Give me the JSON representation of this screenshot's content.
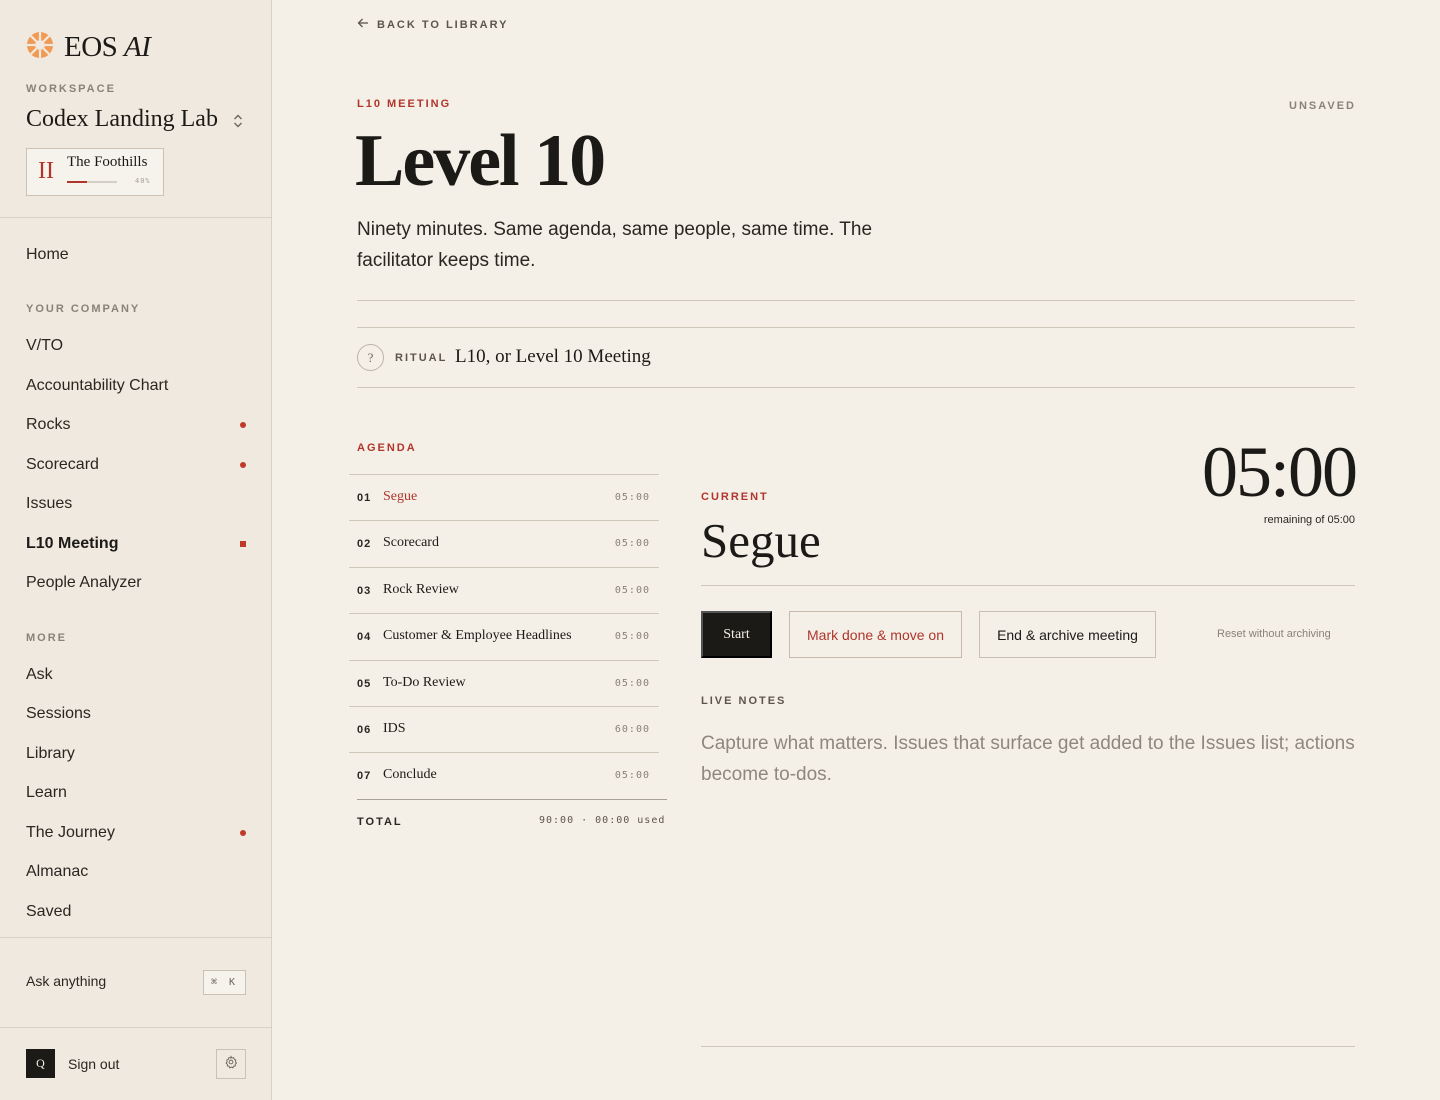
{
  "app": {
    "brand_name": "EOS",
    "brand_suffix": "AI",
    "accent_color": "#b0352b"
  },
  "workspace": {
    "label": "WORKSPACE",
    "name": "Codex Landing Lab",
    "stage": {
      "numeral": "II",
      "name": "The Foothills",
      "progress_pct": 40,
      "progress_label": "40%"
    }
  },
  "nav": {
    "home": "Home",
    "section_company": "YOUR COMPANY",
    "company_items": [
      {
        "label": "V/TO"
      },
      {
        "label": "Accountability Chart"
      },
      {
        "label": "Rocks",
        "indicator": "dot"
      },
      {
        "label": "Scorecard",
        "indicator": "dot"
      },
      {
        "label": "Issues"
      },
      {
        "label": "L10 Meeting",
        "indicator": "square",
        "active": true
      },
      {
        "label": "People Analyzer"
      }
    ],
    "section_more": "MORE",
    "more_items": [
      {
        "label": "Ask"
      },
      {
        "label": "Sessions"
      },
      {
        "label": "Library"
      },
      {
        "label": "Learn"
      },
      {
        "label": "The Journey",
        "indicator": "dot"
      },
      {
        "label": "Almanac"
      },
      {
        "label": "Saved"
      }
    ]
  },
  "footer": {
    "ask_anything": "Ask anything",
    "shortcut": "⌘ K",
    "avatar_initial": "Q",
    "sign_out": "Sign out"
  },
  "main": {
    "back_link": "BACK TO LIBRARY",
    "eyebrow": "L10 MEETING",
    "save_status": "UNSAVED",
    "title": "Level 10",
    "description": "Ninety minutes. Same agenda, same people, same time. The facilitator keeps time.",
    "ritual": {
      "label": "RITUAL",
      "text": "L10, or Level 10 Meeting"
    },
    "agenda": {
      "label": "AGENDA",
      "items": [
        {
          "num": "01",
          "title": "Segue",
          "time": "05:00",
          "current": true
        },
        {
          "num": "02",
          "title": "Scorecard",
          "time": "05:00"
        },
        {
          "num": "03",
          "title": "Rock Review",
          "time": "05:00"
        },
        {
          "num": "04",
          "title": "Customer & Employee Headlines",
          "time": "05:00"
        },
        {
          "num": "05",
          "title": "To-Do Review",
          "time": "05:00"
        },
        {
          "num": "06",
          "title": "IDS",
          "time": "60:00"
        },
        {
          "num": "07",
          "title": "Conclude",
          "time": "05:00"
        }
      ],
      "total_label": "TOTAL",
      "total_value": "90:00 · 00:00 used"
    },
    "current": {
      "label": "CURRENT",
      "title": "Segue",
      "timer": "05:00",
      "remaining": "remaining of 05:00"
    },
    "actions": {
      "start": "Start",
      "mark_done": "Mark done & move on",
      "end_archive": "End & archive meeting",
      "reset": "Reset without archiving"
    },
    "live_notes": {
      "label": "LIVE NOTES",
      "value": "",
      "placeholder": "Capture what matters. Issues that surface get added to the Issues list; actions become to-dos."
    }
  }
}
